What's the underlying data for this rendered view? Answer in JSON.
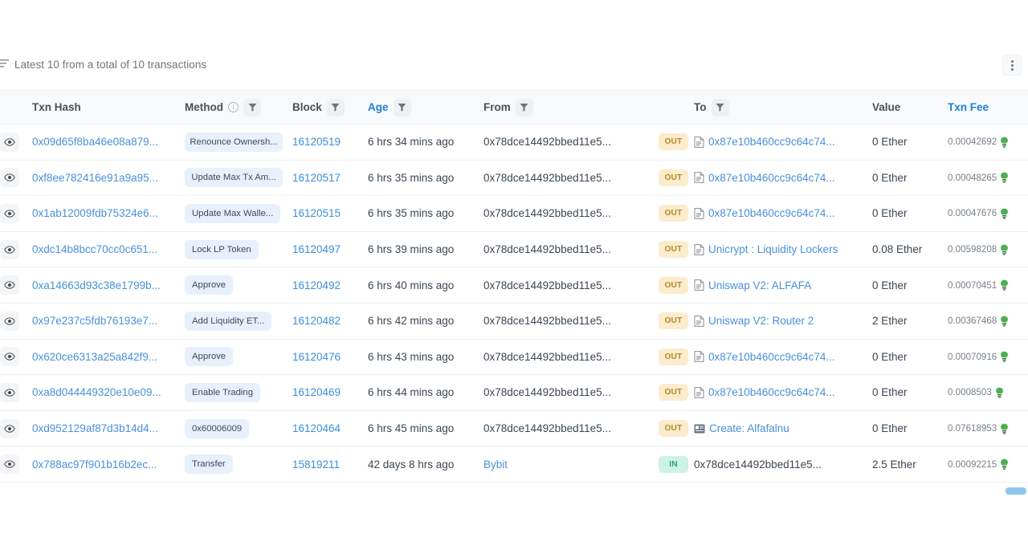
{
  "summary": {
    "icon": "sort-list-icon",
    "text": "Latest 10 from a total of 10 transactions",
    "menu_icon": "kebab-menu-icon"
  },
  "colors": {
    "link_blue": "#4a90d9",
    "header_blue": "#1a82d9",
    "method_pill_bg": "#e8f0fb",
    "out_badge_bg": "#fbeccd",
    "out_badge_fg": "#b78a24",
    "in_badge_bg": "#cdf2e6",
    "in_badge_fg": "#28a07c",
    "header_bg": "#f8f9fa",
    "row_border": "#eceff1",
    "gas_icon_green": "#4caf50",
    "scrollbar_thumb": "#8ec7ef"
  },
  "table": {
    "columns": [
      {
        "key": "eye",
        "label": "",
        "sorted": false,
        "filter": false,
        "info": false
      },
      {
        "key": "hash",
        "label": "Txn Hash",
        "sorted": false,
        "filter": false,
        "info": false
      },
      {
        "key": "method",
        "label": "Method",
        "sorted": false,
        "filter": true,
        "info": true
      },
      {
        "key": "block",
        "label": "Block",
        "sorted": false,
        "filter": true,
        "info": false
      },
      {
        "key": "age",
        "label": "Age",
        "sorted": true,
        "filter": true,
        "info": false
      },
      {
        "key": "from",
        "label": "From",
        "sorted": false,
        "filter": true,
        "info": false
      },
      {
        "key": "dir",
        "label": "",
        "sorted": false,
        "filter": false,
        "info": false
      },
      {
        "key": "to",
        "label": "To",
        "sorted": false,
        "filter": true,
        "info": false
      },
      {
        "key": "value",
        "label": "Value",
        "sorted": false,
        "filter": false,
        "info": false
      },
      {
        "key": "fee",
        "label": "Txn Fee",
        "sorted": true,
        "filter": false,
        "info": false
      }
    ],
    "rows": [
      {
        "hash": "0x09d65f8ba46e08a879...",
        "method": "Renounce Ownersh...",
        "block": "16120519",
        "age": "6 hrs 34 mins ago",
        "from": "0x78dce14492bbed11e5...",
        "from_is_link": false,
        "direction": "OUT",
        "to": "0x87e10b460cc9c64c74...",
        "to_is_link": true,
        "to_icon": "contract-doc-icon",
        "value": "0 Ether",
        "fee": "0.00042692"
      },
      {
        "hash": "0xf8ee782416e91a9a95...",
        "method": "Update Max Tx Am...",
        "block": "16120517",
        "age": "6 hrs 35 mins ago",
        "from": "0x78dce14492bbed11e5...",
        "from_is_link": false,
        "direction": "OUT",
        "to": "0x87e10b460cc9c64c74...",
        "to_is_link": true,
        "to_icon": "contract-doc-icon",
        "value": "0 Ether",
        "fee": "0.00048265"
      },
      {
        "hash": "0x1ab12009fdb75324e6...",
        "method": "Update Max Walle...",
        "block": "16120515",
        "age": "6 hrs 35 mins ago",
        "from": "0x78dce14492bbed11e5...",
        "from_is_link": false,
        "direction": "OUT",
        "to": "0x87e10b460cc9c64c74...",
        "to_is_link": true,
        "to_icon": "contract-doc-icon",
        "value": "0 Ether",
        "fee": "0.00047676"
      },
      {
        "hash": "0xdc14b8bcc70cc0c651...",
        "method": "Lock LP Token",
        "block": "16120497",
        "age": "6 hrs 39 mins ago",
        "from": "0x78dce14492bbed11e5...",
        "from_is_link": false,
        "direction": "OUT",
        "to": "Unicrypt : Liquidity Lockers",
        "to_is_link": true,
        "to_icon": "contract-doc-icon",
        "value": "0.08 Ether",
        "fee": "0.00598208"
      },
      {
        "hash": "0xa14663d93c38e1799b...",
        "method": "Approve",
        "block": "16120492",
        "age": "6 hrs 40 mins ago",
        "from": "0x78dce14492bbed11e5...",
        "from_is_link": false,
        "direction": "OUT",
        "to": "Uniswap V2: ALFAFA",
        "to_is_link": true,
        "to_icon": "contract-doc-icon",
        "value": "0 Ether",
        "fee": "0.00070451"
      },
      {
        "hash": "0x97e237c5fdb76193e7...",
        "method": "Add Liquidity ET...",
        "block": "16120482",
        "age": "6 hrs 42 mins ago",
        "from": "0x78dce14492bbed11e5...",
        "from_is_link": false,
        "direction": "OUT",
        "to": "Uniswap V2: Router 2",
        "to_is_link": true,
        "to_icon": "contract-doc-icon",
        "value": "2 Ether",
        "fee": "0.00367468"
      },
      {
        "hash": "0x620ce6313a25a842f9...",
        "method": "Approve",
        "block": "16120476",
        "age": "6 hrs 43 mins ago",
        "from": "0x78dce14492bbed11e5...",
        "from_is_link": false,
        "direction": "OUT",
        "to": "0x87e10b460cc9c64c74...",
        "to_is_link": true,
        "to_icon": "contract-doc-icon",
        "value": "0 Ether",
        "fee": "0.00070916"
      },
      {
        "hash": "0xa8d044449320e10e09...",
        "method": "Enable Trading",
        "block": "16120469",
        "age": "6 hrs 44 mins ago",
        "from": "0x78dce14492bbed11e5...",
        "from_is_link": false,
        "direction": "OUT",
        "to": "0x87e10b460cc9c64c74...",
        "to_is_link": true,
        "to_icon": "contract-doc-icon",
        "value": "0 Ether",
        "fee": "0.0008503"
      },
      {
        "hash": "0xd952129af87d3b14d4...",
        "method": "0x60006009",
        "block": "16120464",
        "age": "6 hrs 45 mins ago",
        "from": "0x78dce14492bbed11e5...",
        "from_is_link": false,
        "direction": "OUT",
        "to": "Create: Alfafalnu",
        "to_is_link": true,
        "to_icon": "contract-create-icon",
        "value": "0 Ether",
        "fee": "0.07618953"
      },
      {
        "hash": "0x788ac97f901b16b2ec...",
        "method": "Transfer",
        "block": "15819211",
        "age": "42 days 8 hrs ago",
        "from": "Bybit",
        "from_is_link": true,
        "direction": "IN",
        "to": "0x78dce14492bbed11e5...",
        "to_is_link": false,
        "to_icon": "",
        "value": "2.5 Ether",
        "fee": "0.00092215"
      }
    ]
  }
}
